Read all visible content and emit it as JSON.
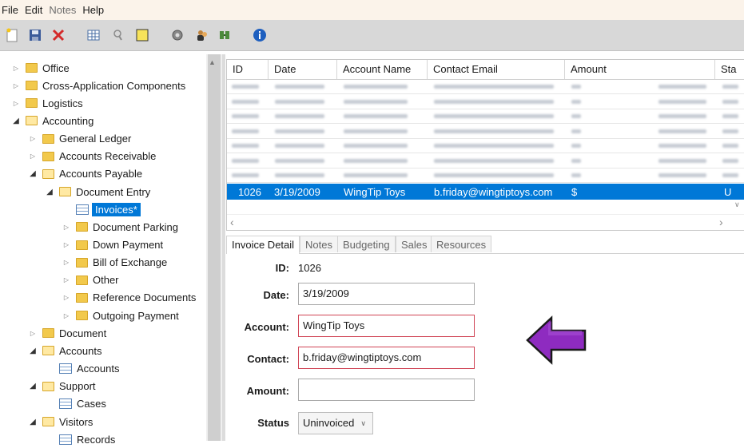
{
  "menu": [
    {
      "label": "File",
      "enabled": true
    },
    {
      "label": "Edit",
      "enabled": true
    },
    {
      "label": "Notes",
      "enabled": false
    },
    {
      "label": "Help",
      "enabled": true
    }
  ],
  "toolbar_icons": [
    "new-document-icon",
    "save-icon",
    "delete-icon",
    "grid-view-icon",
    "search-icon",
    "note-icon",
    "settings-icon",
    "users-icon",
    "connection-icon",
    "info-icon"
  ],
  "tree": [
    {
      "label": "Office",
      "level": 0,
      "expanded": false,
      "icon": "folder-icon"
    },
    {
      "label": "Cross-Application Components",
      "level": 0,
      "expanded": false,
      "icon": "folder-icon"
    },
    {
      "label": "Logistics",
      "level": 0,
      "expanded": false,
      "icon": "folder-icon"
    },
    {
      "label": "Accounting",
      "level": 0,
      "expanded": true,
      "icon": "folder-open-icon"
    },
    {
      "label": "General Ledger",
      "level": 1,
      "expanded": false,
      "icon": "folder-icon"
    },
    {
      "label": "Accounts Receivable",
      "level": 1,
      "expanded": false,
      "icon": "folder-icon"
    },
    {
      "label": "Accounts Payable",
      "level": 1,
      "expanded": true,
      "icon": "folder-open-icon"
    },
    {
      "label": "Document Entry",
      "level": 2,
      "expanded": true,
      "icon": "folder-open-icon"
    },
    {
      "label": "Invoices*",
      "level": 3,
      "expanded": null,
      "icon": "table-icon",
      "selected": true
    },
    {
      "label": "Document Parking",
      "level": 3,
      "expanded": false,
      "icon": "folder-icon"
    },
    {
      "label": "Down Payment",
      "level": 3,
      "expanded": false,
      "icon": "folder-icon"
    },
    {
      "label": "Bill of Exchange",
      "level": 3,
      "expanded": false,
      "icon": "folder-icon"
    },
    {
      "label": "Other",
      "level": 3,
      "expanded": false,
      "icon": "folder-icon"
    },
    {
      "label": "Reference Documents",
      "level": 3,
      "expanded": false,
      "icon": "folder-icon"
    },
    {
      "label": "Outgoing Payment",
      "level": 3,
      "expanded": false,
      "icon": "folder-icon"
    },
    {
      "label": "Document",
      "level": 1,
      "expanded": false,
      "icon": "folder-icon"
    },
    {
      "label": "Accounts",
      "level": 1,
      "expanded": true,
      "icon": "folder-open-icon"
    },
    {
      "label": "Accounts",
      "level": 2,
      "expanded": null,
      "icon": "table-icon"
    },
    {
      "label": "Support",
      "level": 1,
      "expanded": true,
      "icon": "folder-open-icon"
    },
    {
      "label": "Cases",
      "level": 2,
      "expanded": null,
      "icon": "table-icon"
    },
    {
      "label": "Visitors",
      "level": 1,
      "expanded": true,
      "icon": "folder-open-icon"
    },
    {
      "label": "Records",
      "level": 2,
      "expanded": null,
      "icon": "table-icon"
    }
  ],
  "grid": {
    "columns": [
      "ID",
      "Date",
      "Account Name",
      "Contact Email",
      "Amount",
      "Sta"
    ],
    "selected_row": {
      "id": "1026",
      "date": "3/19/2009",
      "account": "WingTip Toys",
      "email": "b.friday@wingtiptoys.com",
      "amount": "$",
      "status": "U"
    }
  },
  "tabs": [
    "Invoice Detail",
    "Notes",
    "Budgeting",
    "Sales",
    "Resources"
  ],
  "form": {
    "id_label": "ID:",
    "id_value": "1026",
    "date_label": "Date:",
    "date_value": "3/19/2009",
    "account_label": "Account:",
    "account_value": "WingTip Toys",
    "contact_label": "Contact:",
    "contact_value": "b.friday@wingtiptoys.com",
    "amount_label": "Amount:",
    "amount_value": "",
    "status_label": "Status",
    "status_value": "Uninvoiced"
  },
  "colors": {
    "accent": "#0078d7",
    "error_border": "#d04455",
    "annotation_arrow": "#8e2bc0"
  }
}
